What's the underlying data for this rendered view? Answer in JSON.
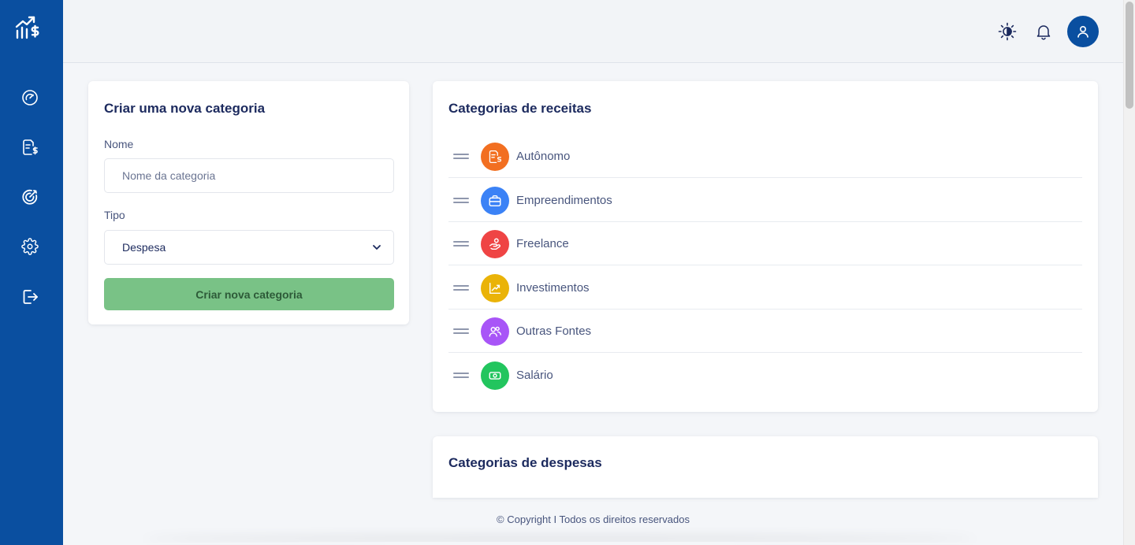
{
  "sidebar": {
    "items": [
      {
        "name": "dashboard"
      },
      {
        "name": "transactions"
      },
      {
        "name": "goals"
      },
      {
        "name": "settings"
      },
      {
        "name": "logout"
      }
    ]
  },
  "form": {
    "title": "Criar uma nova categoria",
    "name_label": "Nome",
    "name_placeholder": "Nome da categoria",
    "name_value": "",
    "type_label": "Tipo",
    "type_value": "Despesa",
    "submit_label": "Criar nova categoria"
  },
  "income": {
    "title": "Categorias de receitas",
    "items": [
      {
        "label": "Autônomo",
        "color": "#f26f21",
        "icon": "invoice-dollar-icon"
      },
      {
        "label": "Empreendimentos",
        "color": "#3b82f6",
        "icon": "briefcase-icon"
      },
      {
        "label": "Freelance",
        "color": "#ef4444",
        "icon": "hand-coin-icon"
      },
      {
        "label": "Investimentos",
        "color": "#eab308",
        "icon": "trend-up-icon"
      },
      {
        "label": "Outras Fontes",
        "color": "#a855f7",
        "icon": "users-icon"
      },
      {
        "label": "Salário",
        "color": "#22c55e",
        "icon": "cash-icon"
      }
    ]
  },
  "expense": {
    "title": "Categorias de despesas"
  },
  "footer": {
    "text": "© Copyright I Todos os direitos reservados"
  },
  "colors": {
    "brand": "#0a4fa0",
    "button": "#79c286"
  }
}
